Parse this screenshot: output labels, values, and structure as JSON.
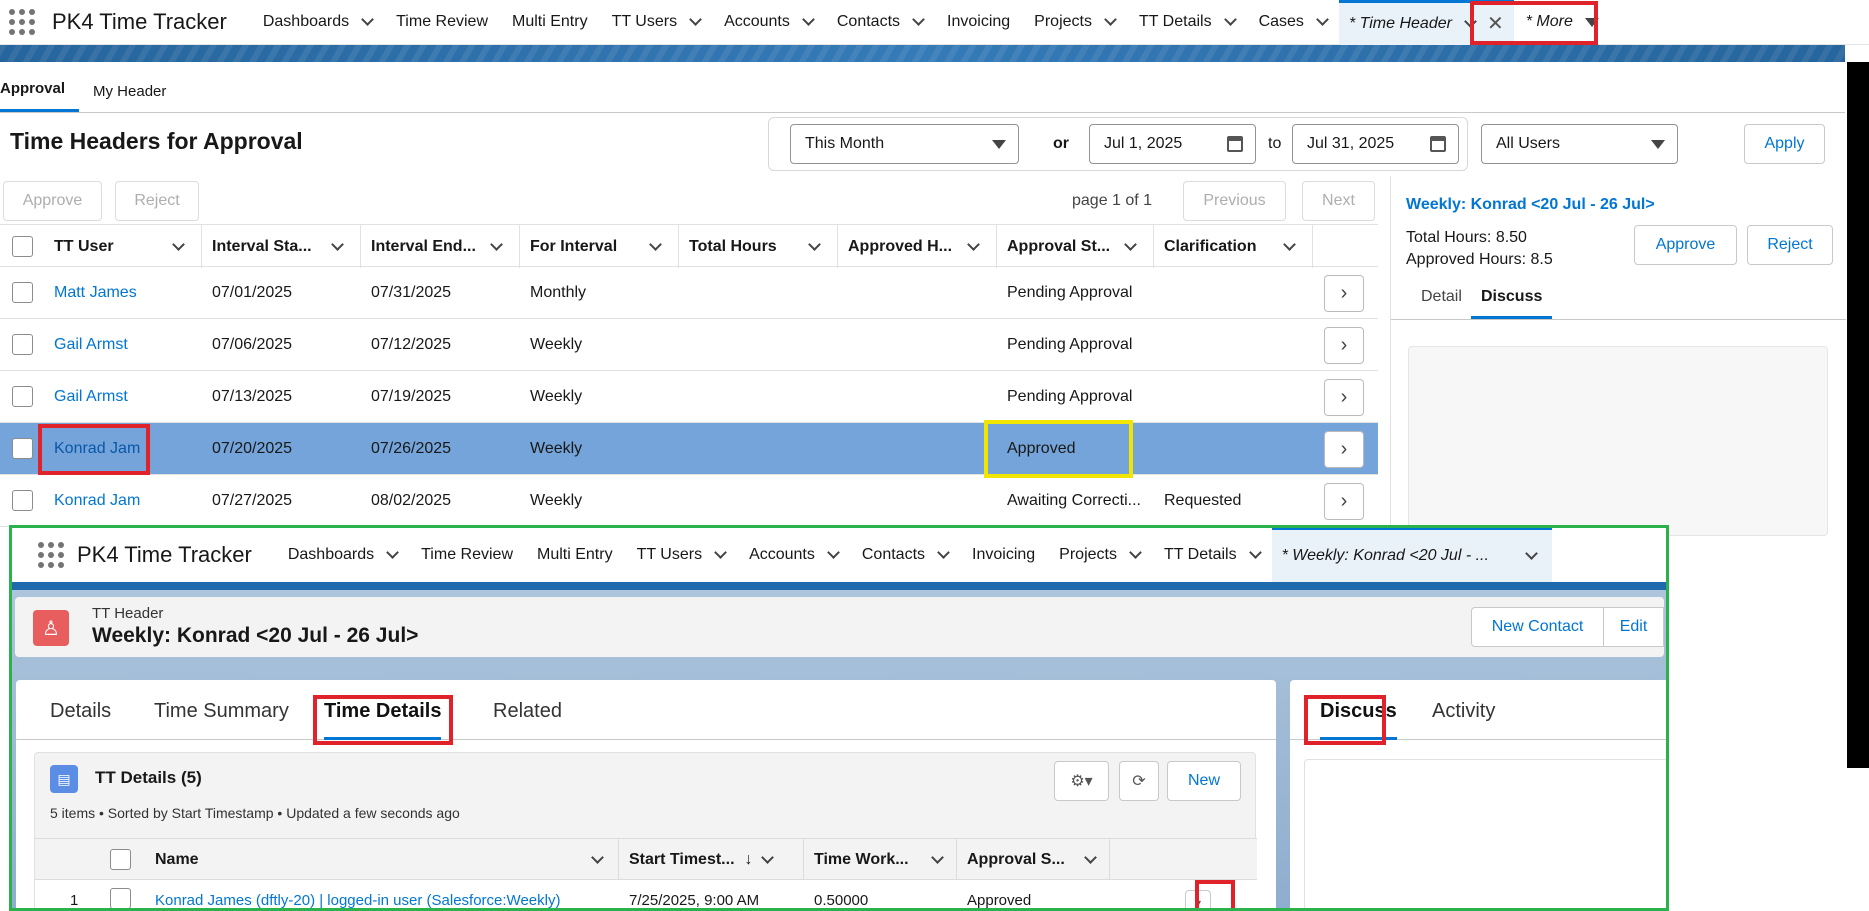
{
  "app_name": "PK4 Time Tracker",
  "nav": [
    "Dashboards",
    "Time Review",
    "Multi Entry",
    "TT Users",
    "Accounts",
    "Contacts",
    "Invoicing",
    "Projects",
    "TT Details",
    "Cases"
  ],
  "nav_chevrons": [
    true,
    false,
    false,
    true,
    true,
    true,
    false,
    true,
    true,
    true
  ],
  "active_tab": "* Time Header",
  "more_tab": "* More",
  "subtabs": [
    "Approval",
    "My Header"
  ],
  "page_title": "Time Headers for Approval",
  "filters": {
    "period": "This Month",
    "or_label": "or",
    "start_date": "Jul 1, 2025",
    "to_label": "to",
    "end_date": "Jul 31, 2025",
    "users": "All Users",
    "apply_label": "Apply"
  },
  "actions": {
    "approve": "Approve",
    "reject": "Reject",
    "page_text": "page 1 of 1",
    "previous": "Previous",
    "next": "Next"
  },
  "table": {
    "columns": [
      "TT User",
      "Interval Sta...",
      "Interval End...",
      "For Interval",
      "Total Hours",
      "Approved H...",
      "Approval St...",
      "Clarification"
    ],
    "rows": [
      {
        "user": "Matt James",
        "start": "07/01/2025",
        "end": "07/31/2025",
        "interval": "Monthly",
        "total": "",
        "approved": "",
        "status": "Pending Approval",
        "clar": "",
        "selected": false
      },
      {
        "user": "Gail Armst",
        "start": "07/06/2025",
        "end": "07/12/2025",
        "interval": "Weekly",
        "total": "",
        "approved": "",
        "status": "Pending Approval",
        "clar": "",
        "selected": false
      },
      {
        "user": "Gail Armst",
        "start": "07/13/2025",
        "end": "07/19/2025",
        "interval": "Weekly",
        "total": "",
        "approved": "",
        "status": "Pending Approval",
        "clar": "",
        "selected": false
      },
      {
        "user": "Konrad Jam",
        "start": "07/20/2025",
        "end": "07/26/2025",
        "interval": "Weekly",
        "total": "",
        "approved": "",
        "status": "Approved",
        "clar": "",
        "selected": true
      },
      {
        "user": "Konrad Jam",
        "start": "07/27/2025",
        "end": "08/02/2025",
        "interval": "Weekly",
        "total": "",
        "approved": "",
        "status": "Awaiting Correcti...",
        "clar": "Requested",
        "selected": false
      }
    ]
  },
  "detail_panel": {
    "title": "Weekly: Konrad <20 Jul - 26 Jul>",
    "total_hours": "Total Hours: 8.50",
    "approved_hours": "Approved Hours: 8.5",
    "approve": "Approve",
    "reject": "Reject",
    "tabs": [
      "Detail",
      "Discuss"
    ],
    "active_tab": "Discuss"
  },
  "overlay": {
    "app_name": "PK4 Time Tracker",
    "nav": [
      "Dashboards",
      "Time Review",
      "Multi Entry",
      "TT Users",
      "Accounts",
      "Contacts",
      "Invoicing",
      "Projects",
      "TT Details"
    ],
    "nav_chevrons": [
      true,
      false,
      false,
      true,
      true,
      true,
      false,
      true,
      true
    ],
    "active_tab": "* Weekly: Konrad <20 Jul - ...",
    "record_type": "TT Header",
    "record_title": "Weekly: Konrad <20 Jul - 26 Jul>",
    "new_contact": "New Contact",
    "edit": "Edit",
    "tabs": [
      "Details",
      "Time Summary",
      "Time Details",
      "Related"
    ],
    "active_main_tab": "Time Details",
    "side_tabs": [
      "Discuss",
      "Activity"
    ],
    "related": {
      "title": "TT Details (5)",
      "meta": "5 items • Sorted by Start Timestamp • Updated a few seconds ago",
      "new_label": "New",
      "columns": [
        "Name",
        "Start Timest...",
        "Time Work...",
        "Approval S..."
      ],
      "rows": [
        {
          "num": "1",
          "name": "Konrad James (dftly-20) | logged-in user (Salesforce:Weekly)",
          "start": "7/25/2025, 9:00 AM",
          "time": "0.50000",
          "status": "Approved"
        }
      ]
    }
  },
  "colors": {
    "accent": "#0176d3",
    "selected_row": "#74a4d9",
    "highlight_red": "#e0222a",
    "highlight_yellow": "#f2e600",
    "highlight_green": "#2bb24c"
  }
}
